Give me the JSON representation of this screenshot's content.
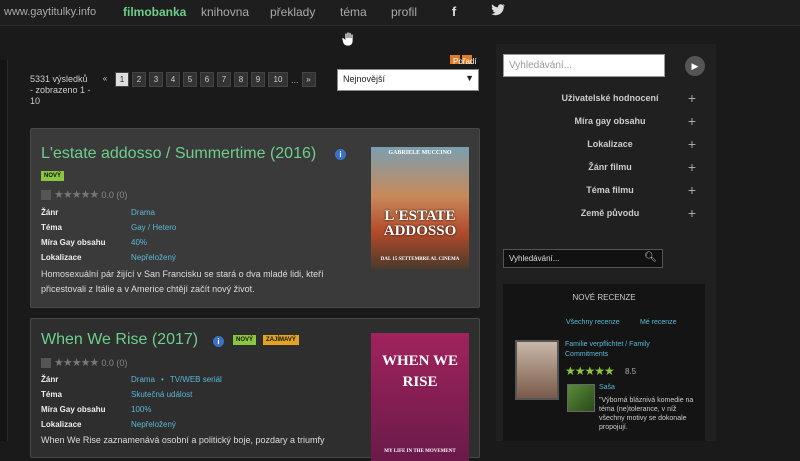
{
  "topbar": {
    "site": "www.gaytitulky.info",
    "nav": [
      "filmobanka",
      "knihovna",
      "překlady",
      "téma",
      "profil"
    ],
    "active": "filmobanka",
    "social": [
      "f",
      "twitter"
    ]
  },
  "listing": {
    "results_text": "5331 výsledků - zobrazeno 1 - 10",
    "pages": [
      "1",
      "2",
      "3",
      "4",
      "5",
      "6",
      "7",
      "8",
      "9",
      "10"
    ],
    "ellipsis": "...",
    "next": "»",
    "current_page": "1",
    "sort_label": "Pořadí",
    "sort_value": "Nejnovější"
  },
  "movies": [
    {
      "title": "L'estate addosso / Summertime (2016)",
      "badges": [
        "NOVÝ"
      ],
      "rating_text": "0.0 (0)",
      "genre_label": "Žánr",
      "genre": "Drama",
      "topic_label": "Téma",
      "topic": "Gay / Hetero",
      "gay_label": "Míra Gay obsahu",
      "gay": "40%",
      "loc_label": "Lokalizace",
      "loc": "Nepřeložený",
      "description": "Homosexuální pár žijící v San Francisku se stará o dva mladé lidi, kteří přicestovali z Itálie a v Americe chtějí začít nový život.",
      "poster_top": "GABRIELE MUCCINO",
      "poster_title": "L'ESTATE ADDOSSO",
      "poster_bottom": "DAL 15 SETTEMBRE AL CINEMA"
    },
    {
      "title": "When We Rise (2017)",
      "badges": [
        "NOVÝ",
        "ZAJÍMAVÝ"
      ],
      "rating_text": "0.0 (0)",
      "genre_label": "Žánr",
      "genre": "Drama",
      "genre2": "TV/WEB seriál",
      "topic_label": "Téma",
      "topic": "Skutečná událost",
      "gay_label": "Míra Gay obsahu",
      "gay": "100%",
      "loc_label": "Lokalizace",
      "loc": "Nepřeložený",
      "description": "When We Rise zaznamenává osobní a politický boje, pozdary a triumfy",
      "poster_title": "WHEN WE RISE",
      "poster_bottom": "MY LIFE IN THE MOVEMENT"
    }
  ],
  "sidebar": {
    "search_placeholder": "Vyhledávání...",
    "filters": [
      "Uživatelské hodnocení",
      "Míra gay obsahu",
      "Lokalizace",
      "Žánr filmu",
      "Téma filmu",
      "Země původu"
    ],
    "search2": "Vyhledávání...",
    "reviews": {
      "title": "NOVÉ RECENZE",
      "all_link": "Všechny recenze",
      "my_link": "Mé recenze",
      "movie": "Familie verpflichtet / Family Commitments",
      "score": "8.5",
      "user": "Saša",
      "text": "\"Výborná bláznivá komedie na téma (ne)tolerance, v níž všechny motivy se dokonale propojují."
    }
  }
}
